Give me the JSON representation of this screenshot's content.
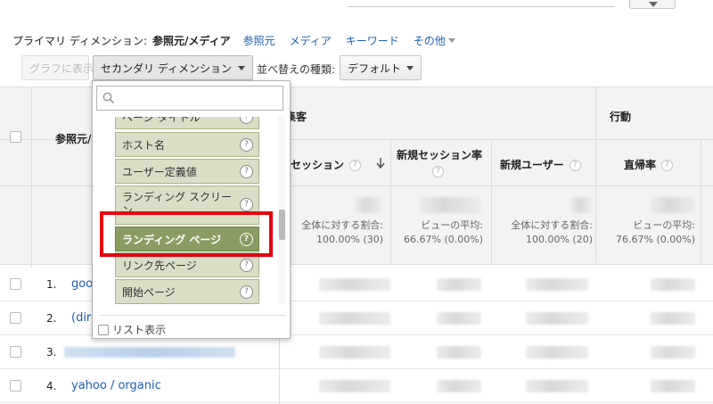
{
  "dimension_bar": {
    "label": "プライマリ ディメンション:",
    "active": "参照元/メディア",
    "links": [
      "参照元",
      "メディア",
      "キーワード",
      "その他"
    ]
  },
  "toolbar": {
    "graph_button": "グラフに表示",
    "secondary_dimension": "セカンダリ ディメンション",
    "sort_label": "並べ替えの種類:",
    "sort_value": "デフォルト"
  },
  "table": {
    "source_header": "参照元/",
    "groups": {
      "acquisition": "集客",
      "behavior": "行動"
    },
    "columns": {
      "sessions": "セッション",
      "new_session_rate": "新規セッション率",
      "new_users": "新規ユーザー",
      "bounce_rate": "直帰率"
    },
    "totals": {
      "sessions": [
        "全体に対する割合:",
        "100.00% (30)"
      ],
      "new_session_rate": [
        "ビューの平均:",
        "66.67% (0.00%)"
      ],
      "new_users": [
        "全体に対する割合:",
        "100.00% (20)"
      ],
      "bounce_rate": [
        "ビューの平均:",
        "76.67% (0.00%)"
      ]
    },
    "rows": [
      {
        "num": "1.",
        "source": "goo"
      },
      {
        "num": "2.",
        "source": "(dire"
      },
      {
        "num": "3.",
        "source": ""
      },
      {
        "num": "4.",
        "source": "yahoo / organic"
      }
    ]
  },
  "dropdown": {
    "search_placeholder": "",
    "items": [
      "ページ タイトル",
      "ホスト名",
      "ユーザー定義値",
      "ランディング スクリーン",
      "ランディング ページ",
      "リンク先ページ",
      "開始ページ"
    ],
    "selected": "ランディング ページ",
    "list_view": "リスト表示"
  },
  "colors": {
    "link": "#1a5fb4",
    "item_bg": "#d9dfc6",
    "item_selected": "#8a9c62",
    "highlight": "#e60012"
  }
}
